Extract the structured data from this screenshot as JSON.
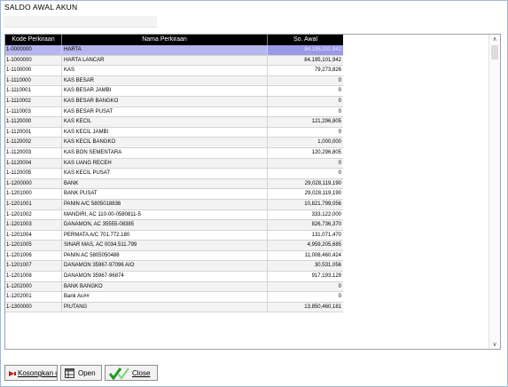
{
  "window": {
    "title": "SALDO AWAL AKUN"
  },
  "grid": {
    "columns": [
      "Kode Perkiraan",
      "Nama Perkiraan",
      "So. Awal"
    ],
    "rows": [
      [
        "1-0000000",
        "HARTA",
        "84,195,101,942"
      ],
      [
        "1-1000000",
        "HARTA LANCAR",
        "84,195,101,942"
      ],
      [
        "1-1100000",
        "KAS",
        "79,273,826"
      ],
      [
        "1-1110000",
        "KAS BESAR",
        "0"
      ],
      [
        "1-1110001",
        "KAS BESAR JAMBI",
        "0"
      ],
      [
        "1-1110002",
        "KAS BESAR BANGKO",
        "0"
      ],
      [
        "1-1110003",
        "KAS BESAR PUSAT",
        "0"
      ],
      [
        "1-1120000",
        "KAS KECIL",
        "121,296,805"
      ],
      [
        "1-1120001",
        "KAS KECIL JAMBI",
        "0"
      ],
      [
        "1-1120002",
        "KAS KECIL BANGKO",
        "1,000,000"
      ],
      [
        "1-1120003",
        "KAS BON SEMENTARA",
        "120,296,805"
      ],
      [
        "1-1120004",
        "KAS UANG RECEH",
        "0"
      ],
      [
        "1-1120005",
        "KAS KECIL PUSAT",
        "0"
      ],
      [
        "1-1200000",
        "BANK",
        "29,028,119,190"
      ],
      [
        "1-1201000",
        "BANK PUSAT",
        "29,028,119,190"
      ],
      [
        "1-1201001",
        "PANIN A/C 5805018836",
        "10,821,799,056"
      ],
      [
        "1-1201002",
        "MANDIRI, AC 110-00-0580811-5",
        "333,122,000"
      ],
      [
        "1-1201003",
        "DANAMON, AC 35555-08385",
        "826,736,370"
      ],
      [
        "1-1201004",
        "PERMATA A/C 701.772.180",
        "131,071,470"
      ],
      [
        "1-1201005",
        "SINAR MAS, AC 0034.511.799",
        "4,959,205,685"
      ],
      [
        "1-1201006",
        "PANIN AC 5805050488",
        "11,008,460,424"
      ],
      [
        "1-1201007",
        "DANAMON 35967-97096 AIO",
        "30,531,056"
      ],
      [
        "1-1201008",
        "DANAMON 35967-96874",
        "917,193,129"
      ],
      [
        "1-1202000",
        "BANK BANGKO",
        "0"
      ],
      [
        "1-1202001",
        "Bank Ac##",
        "0"
      ],
      [
        "1-1300000",
        "PIUTANG",
        "13,850,460,181"
      ]
    ]
  },
  "buttons": {
    "clear": "Kosongkan data",
    "open": "Open",
    "close": "Close"
  },
  "icons": {
    "clear": "delete-arrow-icon",
    "open": "open-table-icon",
    "close": "check-close-icon",
    "scroll_up": "chevron-up-icon",
    "scroll_down": "chevron-down-icon"
  },
  "colors": {
    "selected_row": "#b6b6ee",
    "selected_value": "#9a9ae6",
    "header_bg": "#000000"
  }
}
